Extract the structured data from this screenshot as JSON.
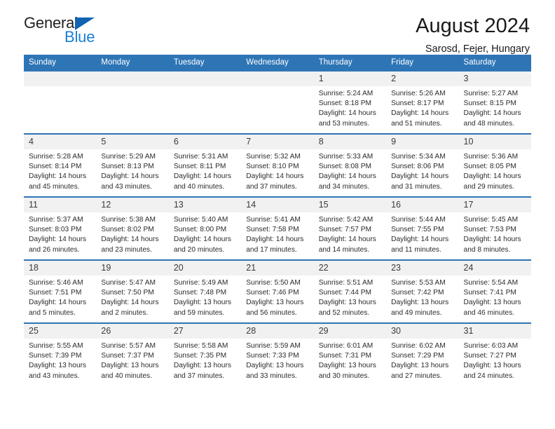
{
  "logo": {
    "word1": "General",
    "word2": "Blue",
    "triangle_color": "#1163b0",
    "blue_color": "#1a7fd4"
  },
  "header": {
    "title": "August 2024",
    "subtitle": "Sarosd, Fejer, Hungary",
    "header_bg": "#2e75b6",
    "daynum_bg": "#f1f1f1"
  },
  "weekdays": [
    "Sunday",
    "Monday",
    "Tuesday",
    "Wednesday",
    "Thursday",
    "Friday",
    "Saturday"
  ],
  "weeks": [
    [
      {
        "empty": true
      },
      {
        "empty": true
      },
      {
        "empty": true
      },
      {
        "empty": true
      },
      {
        "day": "1",
        "sunrise": "Sunrise: 5:24 AM",
        "sunset": "Sunset: 8:18 PM",
        "daylight1": "Daylight: 14 hours",
        "daylight2": "and 53 minutes."
      },
      {
        "day": "2",
        "sunrise": "Sunrise: 5:26 AM",
        "sunset": "Sunset: 8:17 PM",
        "daylight1": "Daylight: 14 hours",
        "daylight2": "and 51 minutes."
      },
      {
        "day": "3",
        "sunrise": "Sunrise: 5:27 AM",
        "sunset": "Sunset: 8:15 PM",
        "daylight1": "Daylight: 14 hours",
        "daylight2": "and 48 minutes."
      }
    ],
    [
      {
        "day": "4",
        "sunrise": "Sunrise: 5:28 AM",
        "sunset": "Sunset: 8:14 PM",
        "daylight1": "Daylight: 14 hours",
        "daylight2": "and 45 minutes."
      },
      {
        "day": "5",
        "sunrise": "Sunrise: 5:29 AM",
        "sunset": "Sunset: 8:13 PM",
        "daylight1": "Daylight: 14 hours",
        "daylight2": "and 43 minutes."
      },
      {
        "day": "6",
        "sunrise": "Sunrise: 5:31 AM",
        "sunset": "Sunset: 8:11 PM",
        "daylight1": "Daylight: 14 hours",
        "daylight2": "and 40 minutes."
      },
      {
        "day": "7",
        "sunrise": "Sunrise: 5:32 AM",
        "sunset": "Sunset: 8:10 PM",
        "daylight1": "Daylight: 14 hours",
        "daylight2": "and 37 minutes."
      },
      {
        "day": "8",
        "sunrise": "Sunrise: 5:33 AM",
        "sunset": "Sunset: 8:08 PM",
        "daylight1": "Daylight: 14 hours",
        "daylight2": "and 34 minutes."
      },
      {
        "day": "9",
        "sunrise": "Sunrise: 5:34 AM",
        "sunset": "Sunset: 8:06 PM",
        "daylight1": "Daylight: 14 hours",
        "daylight2": "and 31 minutes."
      },
      {
        "day": "10",
        "sunrise": "Sunrise: 5:36 AM",
        "sunset": "Sunset: 8:05 PM",
        "daylight1": "Daylight: 14 hours",
        "daylight2": "and 29 minutes."
      }
    ],
    [
      {
        "day": "11",
        "sunrise": "Sunrise: 5:37 AM",
        "sunset": "Sunset: 8:03 PM",
        "daylight1": "Daylight: 14 hours",
        "daylight2": "and 26 minutes."
      },
      {
        "day": "12",
        "sunrise": "Sunrise: 5:38 AM",
        "sunset": "Sunset: 8:02 PM",
        "daylight1": "Daylight: 14 hours",
        "daylight2": "and 23 minutes."
      },
      {
        "day": "13",
        "sunrise": "Sunrise: 5:40 AM",
        "sunset": "Sunset: 8:00 PM",
        "daylight1": "Daylight: 14 hours",
        "daylight2": "and 20 minutes."
      },
      {
        "day": "14",
        "sunrise": "Sunrise: 5:41 AM",
        "sunset": "Sunset: 7:58 PM",
        "daylight1": "Daylight: 14 hours",
        "daylight2": "and 17 minutes."
      },
      {
        "day": "15",
        "sunrise": "Sunrise: 5:42 AM",
        "sunset": "Sunset: 7:57 PM",
        "daylight1": "Daylight: 14 hours",
        "daylight2": "and 14 minutes."
      },
      {
        "day": "16",
        "sunrise": "Sunrise: 5:44 AM",
        "sunset": "Sunset: 7:55 PM",
        "daylight1": "Daylight: 14 hours",
        "daylight2": "and 11 minutes."
      },
      {
        "day": "17",
        "sunrise": "Sunrise: 5:45 AM",
        "sunset": "Sunset: 7:53 PM",
        "daylight1": "Daylight: 14 hours",
        "daylight2": "and 8 minutes."
      }
    ],
    [
      {
        "day": "18",
        "sunrise": "Sunrise: 5:46 AM",
        "sunset": "Sunset: 7:51 PM",
        "daylight1": "Daylight: 14 hours",
        "daylight2": "and 5 minutes."
      },
      {
        "day": "19",
        "sunrise": "Sunrise: 5:47 AM",
        "sunset": "Sunset: 7:50 PM",
        "daylight1": "Daylight: 14 hours",
        "daylight2": "and 2 minutes."
      },
      {
        "day": "20",
        "sunrise": "Sunrise: 5:49 AM",
        "sunset": "Sunset: 7:48 PM",
        "daylight1": "Daylight: 13 hours",
        "daylight2": "and 59 minutes."
      },
      {
        "day": "21",
        "sunrise": "Sunrise: 5:50 AM",
        "sunset": "Sunset: 7:46 PM",
        "daylight1": "Daylight: 13 hours",
        "daylight2": "and 56 minutes."
      },
      {
        "day": "22",
        "sunrise": "Sunrise: 5:51 AM",
        "sunset": "Sunset: 7:44 PM",
        "daylight1": "Daylight: 13 hours",
        "daylight2": "and 52 minutes."
      },
      {
        "day": "23",
        "sunrise": "Sunrise: 5:53 AM",
        "sunset": "Sunset: 7:42 PM",
        "daylight1": "Daylight: 13 hours",
        "daylight2": "and 49 minutes."
      },
      {
        "day": "24",
        "sunrise": "Sunrise: 5:54 AM",
        "sunset": "Sunset: 7:41 PM",
        "daylight1": "Daylight: 13 hours",
        "daylight2": "and 46 minutes."
      }
    ],
    [
      {
        "day": "25",
        "sunrise": "Sunrise: 5:55 AM",
        "sunset": "Sunset: 7:39 PM",
        "daylight1": "Daylight: 13 hours",
        "daylight2": "and 43 minutes."
      },
      {
        "day": "26",
        "sunrise": "Sunrise: 5:57 AM",
        "sunset": "Sunset: 7:37 PM",
        "daylight1": "Daylight: 13 hours",
        "daylight2": "and 40 minutes."
      },
      {
        "day": "27",
        "sunrise": "Sunrise: 5:58 AM",
        "sunset": "Sunset: 7:35 PM",
        "daylight1": "Daylight: 13 hours",
        "daylight2": "and 37 minutes."
      },
      {
        "day": "28",
        "sunrise": "Sunrise: 5:59 AM",
        "sunset": "Sunset: 7:33 PM",
        "daylight1": "Daylight: 13 hours",
        "daylight2": "and 33 minutes."
      },
      {
        "day": "29",
        "sunrise": "Sunrise: 6:01 AM",
        "sunset": "Sunset: 7:31 PM",
        "daylight1": "Daylight: 13 hours",
        "daylight2": "and 30 minutes."
      },
      {
        "day": "30",
        "sunrise": "Sunrise: 6:02 AM",
        "sunset": "Sunset: 7:29 PM",
        "daylight1": "Daylight: 13 hours",
        "daylight2": "and 27 minutes."
      },
      {
        "day": "31",
        "sunrise": "Sunrise: 6:03 AM",
        "sunset": "Sunset: 7:27 PM",
        "daylight1": "Daylight: 13 hours",
        "daylight2": "and 24 minutes."
      }
    ]
  ]
}
